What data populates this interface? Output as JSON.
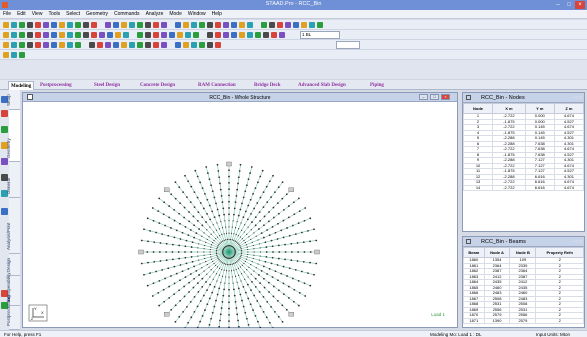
{
  "window": {
    "title": "STAAD.Pro - RCC_Bin"
  },
  "menu": [
    "File",
    "Edit",
    "View",
    "Tools",
    "Select",
    "Geometry",
    "Commands",
    "Analyze",
    "Mode",
    "Window",
    "Help"
  ],
  "toolbar": {
    "filter_value": "1 BL",
    "unit_value": ""
  },
  "ribbon_tabs": [
    "Modeling",
    "Postprocessing",
    "Steel Design",
    "Concrete Design",
    "RAM Connection",
    "Bridge Deck",
    "Advanced Slab Design",
    "Piping"
  ],
  "page_tabs": [
    "Setup",
    "Geometry",
    "General",
    "Analysis/Print",
    "Design",
    "Foundation",
    "Interoperability",
    "Postprocessing"
  ],
  "page_tab_sub": [
    "Job Info",
    "Beam",
    "Plate",
    "Solid",
    "Property",
    "Spec",
    "Support",
    "Load & Definition",
    "Material"
  ],
  "viewport": {
    "title": "RCC_Bin - Whole Structure",
    "load_label": "Load 1"
  },
  "nodes_table": {
    "title": "RCC_Bin - Nodes",
    "columns": [
      "Node",
      "X\nm",
      "Y\nm",
      "Z\nm"
    ],
    "rows": [
      [
        "1",
        "-2.722",
        "0.000",
        "4.674"
      ],
      [
        "2",
        "-1.875",
        "0.000",
        "4.527"
      ],
      [
        "3",
        "-2.722",
        "0.145",
        "4.674"
      ],
      [
        "4",
        "-1.875",
        "0.145",
        "4.527"
      ],
      [
        "5",
        "-2.288",
        "0.145",
        "4.301"
      ],
      [
        "6",
        "-2.288",
        "7.638",
        "4.301"
      ],
      [
        "7",
        "-2.722",
        "7.638",
        "4.674"
      ],
      [
        "8",
        "-1.875",
        "7.638",
        "4.527"
      ],
      [
        "9",
        "-2.288",
        "7.127",
        "4.301"
      ],
      [
        "10",
        "-2.722",
        "7.127",
        "4.674"
      ],
      [
        "11",
        "-1.875",
        "7.127",
        "4.527"
      ],
      [
        "12",
        "-2.288",
        "6.616",
        "4.301"
      ],
      [
        "13",
        "-2.722",
        "6.616",
        "4.674"
      ],
      [
        "14",
        "-2.722",
        "6.616",
        "4.674"
      ]
    ]
  },
  "beams_table": {
    "title": "RCC_Bin - Beams",
    "columns": [
      "Beam",
      "Node A",
      "Node B",
      "Property Refn"
    ],
    "rows": [
      [
        "1860",
        "1354",
        "109",
        "2"
      ],
      [
        "1861",
        "2364",
        "2339",
        "2"
      ],
      [
        "1862",
        "2387",
        "2364",
        "2"
      ],
      [
        "1863",
        "2412",
        "2387",
        "2"
      ],
      [
        "1864",
        "2435",
        "2412",
        "2"
      ],
      [
        "1865",
        "2460",
        "2435",
        "2"
      ],
      [
        "1866",
        "2483",
        "2460",
        "2"
      ],
      [
        "1867",
        "2508",
        "2483",
        "2"
      ],
      [
        "1868",
        "2531",
        "2508",
        "2"
      ],
      [
        "1869",
        "2556",
        "2531",
        "2"
      ],
      [
        "1870",
        "2579",
        "2556",
        "2"
      ],
      [
        "1871",
        "1390",
        "2579",
        "2"
      ]
    ]
  },
  "status": {
    "left": "For Help, press F1",
    "mid": "Modeling Mo: Load 1 : DL",
    "right": "Input Units: Mton"
  },
  "colors": {
    "accent": "#6f8fd6",
    "radial": "#2aa07a",
    "ribbon_text": "#8f2fa0"
  }
}
